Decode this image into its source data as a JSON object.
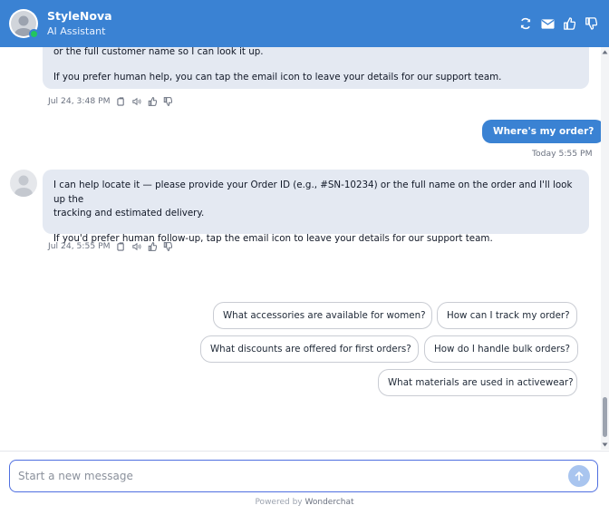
{
  "header": {
    "title": "StyleNova",
    "subtitle": "AI Assistant",
    "actions": [
      "refresh-icon",
      "email-icon",
      "thumbs-up-icon",
      "thumbs-down-icon"
    ]
  },
  "messages": [
    {
      "role": "bot",
      "lines": [
        "or the full customer name so I can look it up.",
        "If you prefer human help, you can tap the email icon to leave your details for our support team."
      ],
      "time": "Jul 24, 3:48 PM"
    },
    {
      "role": "user",
      "text": "Where's my order?",
      "time": "Today 5:55 PM"
    },
    {
      "role": "bot",
      "line1": "I can help locate it — please provide your Order ID (e.g., #SN-10234) or the full name on the order and I'll look up the",
      "line1b": "tracking and estimated delivery.",
      "line2": "If you'd prefer human follow-up, tap the email icon to leave your details for our support team.",
      "time": "Jul 24, 5:55 PM"
    }
  ],
  "suggestions": [
    "What accessories are available for women?",
    "How can I track my order?",
    "What discounts are offered for first orders?",
    "How do I handle bulk orders?",
    "What materials are used in activewear?"
  ],
  "composer": {
    "placeholder": "Start a new message"
  },
  "footer": {
    "prefix": "Powered by",
    "brand": "Wonderchat"
  },
  "colors": {
    "accent": "#3a82d3",
    "bot_bubble": "#e4e9f2",
    "online": "#22c55e"
  }
}
